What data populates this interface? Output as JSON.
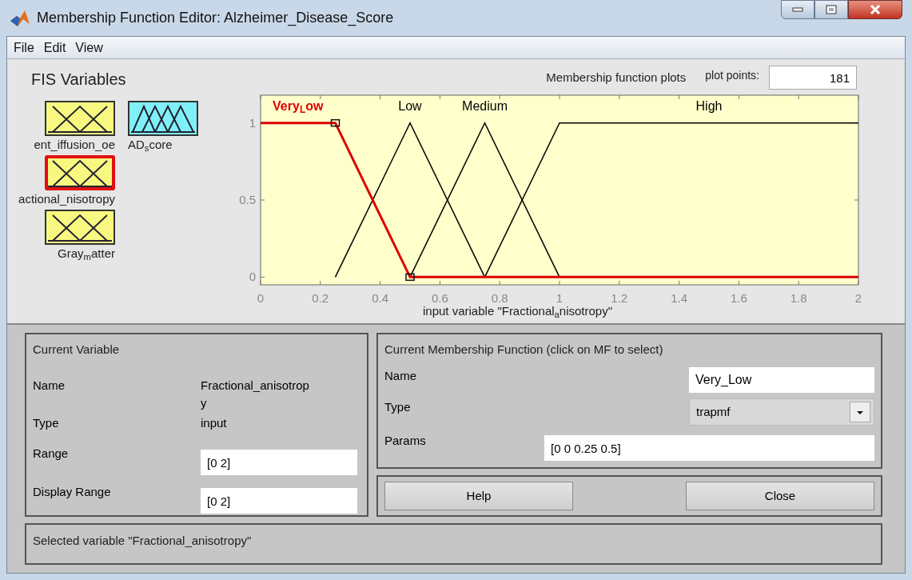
{
  "window": {
    "title": "Membership Function Editor: Alzheimer_Disease_Score"
  },
  "menu": [
    "File",
    "Edit",
    "View"
  ],
  "fis_variables": {
    "title": "FIS Variables",
    "items": [
      {
        "label": "ent_iffusion_oe",
        "kind": "input",
        "selected": false
      },
      {
        "label": "AD$_{s}$core",
        "kind": "output",
        "selected": false
      },
      {
        "label": "actional_nisotropy",
        "kind": "input",
        "selected": true
      },
      {
        "label": "Gray$_{m}$atter",
        "kind": "input",
        "selected": false
      }
    ]
  },
  "plot": {
    "title": "Membership function plots",
    "plot_points_label": "plot points:",
    "plot_points": "181",
    "membership_functions": [
      {
        "selected": true
      },
      {
        "selected": false
      },
      {
        "selected": false
      },
      {
        "selected": false
      }
    ],
    "chart_data": {
      "type": "line",
      "xlabel": "input variable \"Fractional$_{a}$nisotropy\"",
      "x": [
        0,
        0.25,
        0.5,
        0.75,
        1,
        2
      ],
      "series": [
        {
          "name": "Very$_{L}$ow",
          "color": "#dd0000",
          "values": [
            1,
            1,
            0,
            0,
            0,
            0
          ]
        },
        {
          "name": "Low",
          "color": "#000000",
          "values": [
            null,
            0,
            1,
            0,
            null,
            null
          ]
        },
        {
          "name": "Medium",
          "color": "#000000",
          "values": [
            null,
            null,
            0,
            1,
            0,
            null
          ]
        },
        {
          "name": "High",
          "color": "#000000",
          "values": [
            null,
            null,
            null,
            0,
            1,
            1
          ]
        }
      ],
      "xlim": [
        0,
        2
      ],
      "ylim": [
        -0.05,
        1.18
      ],
      "xticks": [
        0,
        0.2,
        0.4,
        0.6,
        0.8,
        1,
        1.2,
        1.4,
        1.6,
        1.8,
        2
      ],
      "yticks": [
        0,
        0.5,
        1
      ]
    }
  },
  "current_variable": {
    "title": "Current Variable",
    "name_label": "Name",
    "name": "Fractional_anisotropy",
    "type_label": "Type",
    "type": "input",
    "range_label": "Range",
    "range": "[0 2]",
    "display_range_label": "Display Range",
    "display_range": "[0 2]"
  },
  "current_mf": {
    "title": "Current Membership Function (click on MF to select)",
    "name_label": "Name",
    "name": "Very_Low",
    "type_label": "Type",
    "type": "trapmf",
    "params_label": "Params",
    "params": "[0 0 0.25 0.5]"
  },
  "buttons": [
    "Help",
    "Close"
  ],
  "status": "Selected variable \"Fractional_anisotropy\""
}
